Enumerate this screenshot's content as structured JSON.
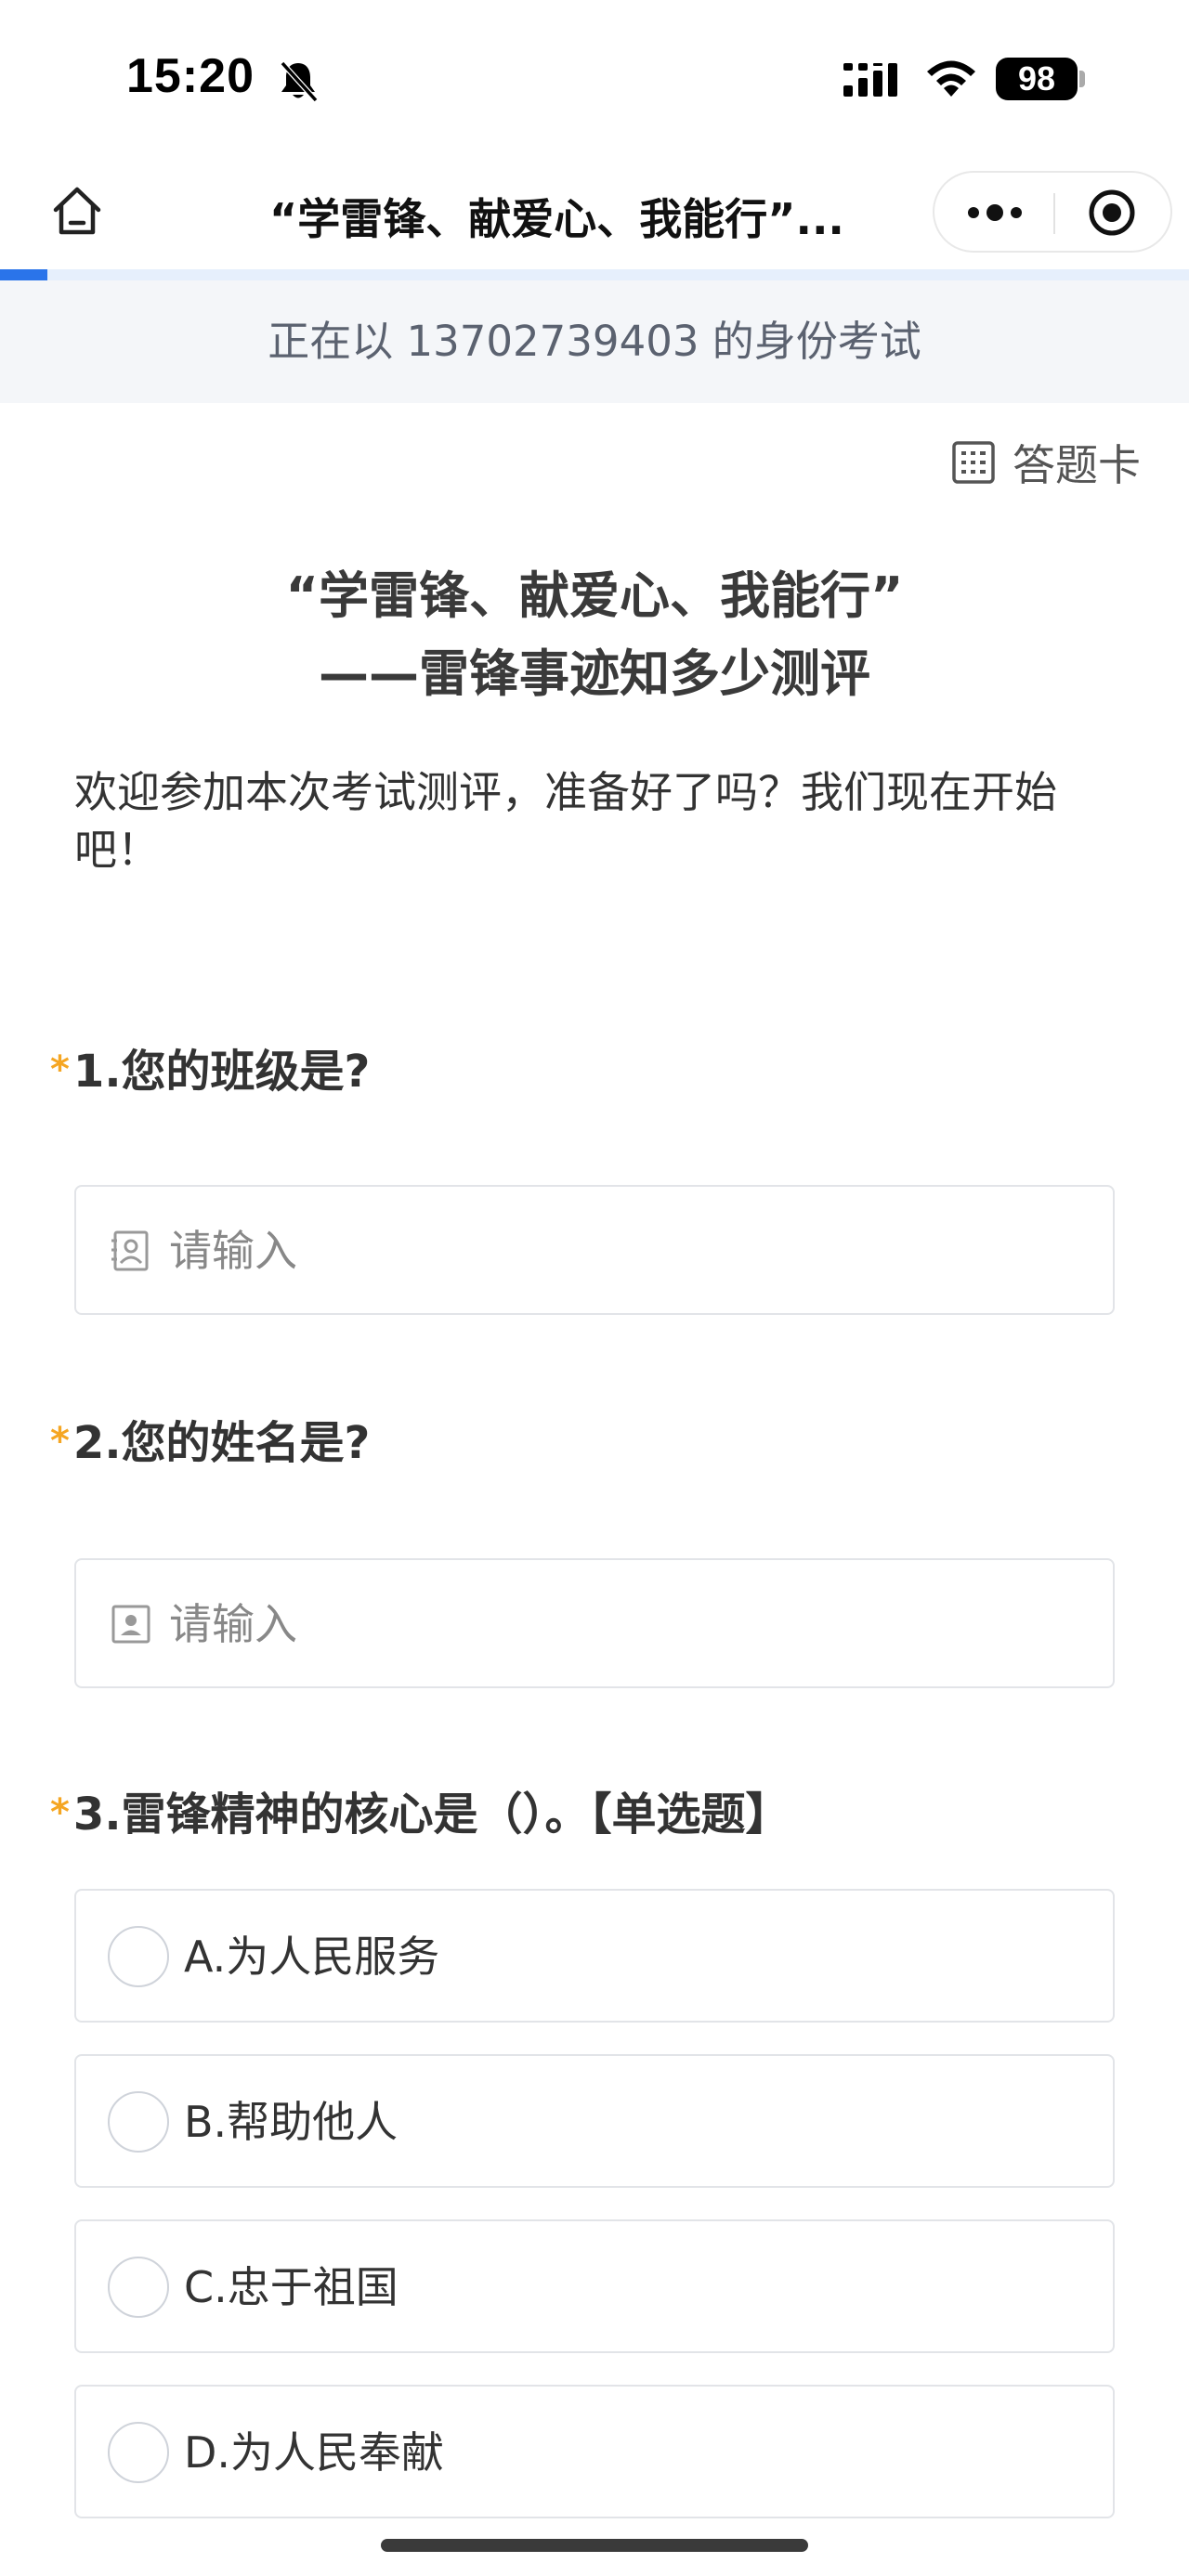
{
  "status_bar": {
    "time": "15:20",
    "battery": "98",
    "icons": [
      "bell-slash-icon",
      "signal-icon",
      "wifi-icon",
      "battery-icon"
    ]
  },
  "nav": {
    "title": "“学雷锋、献爱心、我能行”...",
    "icons": [
      "home-icon",
      "more-icon",
      "close-target-icon"
    ]
  },
  "progress": {
    "fraction": 0.04,
    "color": "#2a74ea"
  },
  "identity_banner": "正在以 13702739403 的身份考试",
  "answer_card": {
    "label": "答题卡",
    "icon": "grid-card-icon"
  },
  "survey": {
    "title_line1": "“学雷锋、献爱心、我能行”",
    "title_line2": "——雷锋事迹知多少测评",
    "intro": "欢迎参加本次考试测评，准备好了吗？我们现在开始吧！"
  },
  "questions": [
    {
      "required_mark": "*",
      "title": "1.您的班级是?",
      "placeholder": "请输入",
      "icon": "class-card-icon"
    },
    {
      "required_mark": "*",
      "title": "2.您的姓名是?",
      "placeholder": "请输入",
      "icon": "person-card-icon"
    },
    {
      "required_mark": "*",
      "title": "3.雷锋精神的核心是（）。【单选题】",
      "options": [
        "A.为人民服务",
        "B.帮助他人",
        "C.忠于祖国",
        "D.为人民奉献"
      ]
    }
  ],
  "colors": {
    "accent": "#2a74ea",
    "required": "#f5a623",
    "banner_bg": "#f4f6f9",
    "border": "#e2e4e8"
  }
}
